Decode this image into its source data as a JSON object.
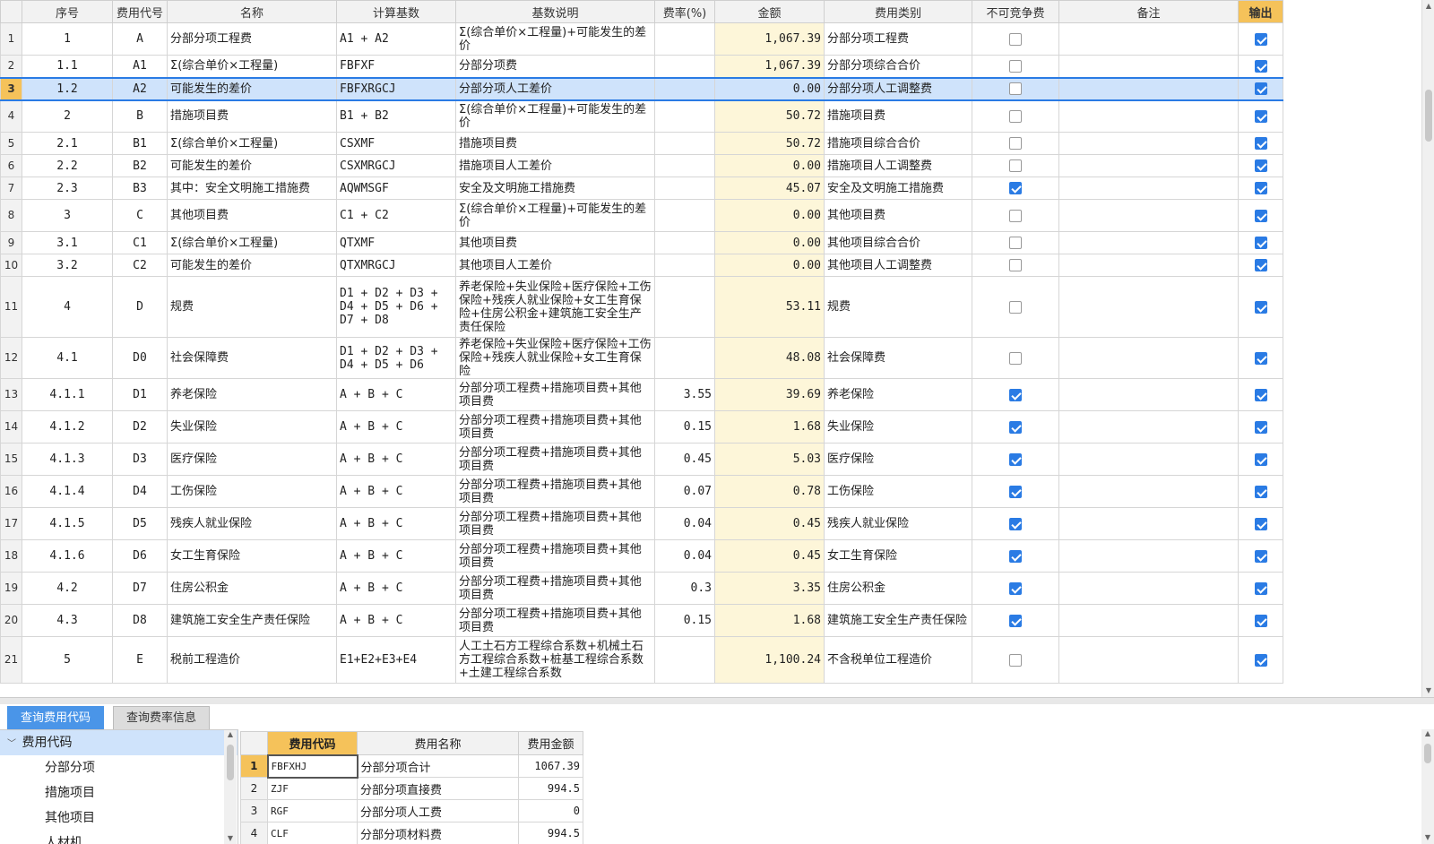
{
  "main_table": {
    "columns": [
      "序号",
      "费用代号",
      "名称",
      "计算基数",
      "基数说明",
      "费率(%)",
      "金额",
      "费用类别",
      "不可竞争费",
      "备注",
      "输出"
    ],
    "rows": [
      {
        "n": "1",
        "seq": "1",
        "code": "A",
        "name": "分部分项工程费",
        "base": "A1 + A2",
        "desc": "Σ(综合单价×工程量)+可能发生的差价",
        "rate": "",
        "amount": "1,067.39",
        "category": "分部分项工程费",
        "noncomp": false,
        "remark": "",
        "output": true
      },
      {
        "n": "2",
        "seq": "1.1",
        "code": "A1",
        "name": "Σ(综合单价×工程量)",
        "base": "FBFXF",
        "desc": "分部分项费",
        "rate": "",
        "amount": "1,067.39",
        "category": "分部分项综合合价",
        "noncomp": false,
        "remark": "",
        "output": true
      },
      {
        "n": "3",
        "seq": "1.2",
        "code": "A2",
        "name": "可能发生的差价",
        "base": "FBFXRGCJ",
        "desc": "分部分项人工差价",
        "rate": "",
        "amount": "0.00",
        "category": "分部分项人工调整费",
        "noncomp": false,
        "remark": "",
        "output": true,
        "selected": true
      },
      {
        "n": "4",
        "seq": "2",
        "code": "B",
        "name": "措施项目费",
        "base": "B1 + B2",
        "desc": "Σ(综合单价×工程量)+可能发生的差价",
        "rate": "",
        "amount": "50.72",
        "category": "措施项目费",
        "noncomp": false,
        "remark": "",
        "output": true
      },
      {
        "n": "5",
        "seq": "2.1",
        "code": "B1",
        "name": "Σ(综合单价×工程量)",
        "base": "CSXMF",
        "desc": "措施项目费",
        "rate": "",
        "amount": "50.72",
        "category": "措施项目综合合价",
        "noncomp": false,
        "remark": "",
        "output": true
      },
      {
        "n": "6",
        "seq": "2.2",
        "code": "B2",
        "name": "可能发生的差价",
        "base": "CSXMRGCJ",
        "desc": "措施项目人工差价",
        "rate": "",
        "amount": "0.00",
        "category": "措施项目人工调整费",
        "noncomp": false,
        "remark": "",
        "output": true
      },
      {
        "n": "7",
        "seq": "2.3",
        "code": "B3",
        "name": "其中：安全文明施工措施费",
        "base": "AQWMSGF",
        "desc": "安全及文明施工措施费",
        "rate": "",
        "amount": "45.07",
        "category": "安全及文明施工措施费",
        "noncomp": true,
        "remark": "",
        "output": true
      },
      {
        "n": "8",
        "seq": "3",
        "code": "C",
        "name": "其他项目费",
        "base": "C1 + C2",
        "desc": "Σ(综合单价×工程量)+可能发生的差价",
        "rate": "",
        "amount": "0.00",
        "category": "其他项目费",
        "noncomp": false,
        "remark": "",
        "output": true
      },
      {
        "n": "9",
        "seq": "3.1",
        "code": "C1",
        "name": "Σ(综合单价×工程量)",
        "base": "QTXMF",
        "desc": "其他项目费",
        "rate": "",
        "amount": "0.00",
        "category": "其他项目综合合价",
        "noncomp": false,
        "remark": "",
        "output": true
      },
      {
        "n": "10",
        "seq": "3.2",
        "code": "C2",
        "name": "可能发生的差价",
        "base": "QTXMRGCJ",
        "desc": "其他项目人工差价",
        "rate": "",
        "amount": "0.00",
        "category": "其他项目人工调整费",
        "noncomp": false,
        "remark": "",
        "output": true
      },
      {
        "n": "11",
        "seq": "4",
        "code": "D",
        "name": "规费",
        "base": "D1 + D2 + D3 + D4 + D5 + D6 + D7 + D8",
        "desc": "养老保险+失业保险+医疗保险+工伤保险+残疾人就业保险+女工生育保险+住房公积金+建筑施工安全生产责任保险",
        "rate": "",
        "amount": "53.11",
        "category": "规费",
        "noncomp": false,
        "remark": "",
        "output": true
      },
      {
        "n": "12",
        "seq": "4.1",
        "code": "D0",
        "name": "社会保障费",
        "base": "D1 + D2 + D3 + D4 + D5 + D6",
        "desc": "养老保险+失业保险+医疗保险+工伤保险+残疾人就业保险+女工生育保险",
        "rate": "",
        "amount": "48.08",
        "category": "社会保障费",
        "noncomp": false,
        "remark": "",
        "output": true
      },
      {
        "n": "13",
        "seq": "4.1.1",
        "code": "D1",
        "name": "养老保险",
        "base": "A + B + C",
        "desc": "分部分项工程费+措施项目费+其他项目费",
        "rate": "3.55",
        "amount": "39.69",
        "category": "养老保险",
        "noncomp": true,
        "remark": "",
        "output": true
      },
      {
        "n": "14",
        "seq": "4.1.2",
        "code": "D2",
        "name": "失业保险",
        "base": "A + B + C",
        "desc": "分部分项工程费+措施项目费+其他项目费",
        "rate": "0.15",
        "amount": "1.68",
        "category": "失业保险",
        "noncomp": true,
        "remark": "",
        "output": true
      },
      {
        "n": "15",
        "seq": "4.1.3",
        "code": "D3",
        "name": "医疗保险",
        "base": "A + B + C",
        "desc": "分部分项工程费+措施项目费+其他项目费",
        "rate": "0.45",
        "amount": "5.03",
        "category": "医疗保险",
        "noncomp": true,
        "remark": "",
        "output": true
      },
      {
        "n": "16",
        "seq": "4.1.4",
        "code": "D4",
        "name": "工伤保险",
        "base": "A + B + C",
        "desc": "分部分项工程费+措施项目费+其他项目费",
        "rate": "0.07",
        "amount": "0.78",
        "category": "工伤保险",
        "noncomp": true,
        "remark": "",
        "output": true
      },
      {
        "n": "17",
        "seq": "4.1.5",
        "code": "D5",
        "name": "残疾人就业保险",
        "base": "A + B + C",
        "desc": "分部分项工程费+措施项目费+其他项目费",
        "rate": "0.04",
        "amount": "0.45",
        "category": "残疾人就业保险",
        "noncomp": true,
        "remark": "",
        "output": true
      },
      {
        "n": "18",
        "seq": "4.1.6",
        "code": "D6",
        "name": "女工生育保险",
        "base": "A + B + C",
        "desc": "分部分项工程费+措施项目费+其他项目费",
        "rate": "0.04",
        "amount": "0.45",
        "category": "女工生育保险",
        "noncomp": true,
        "remark": "",
        "output": true
      },
      {
        "n": "19",
        "seq": "4.2",
        "code": "D7",
        "name": "住房公积金",
        "base": "A + B + C",
        "desc": "分部分项工程费+措施项目费+其他项目费",
        "rate": "0.3",
        "amount": "3.35",
        "category": "住房公积金",
        "noncomp": true,
        "remark": "",
        "output": true
      },
      {
        "n": "20",
        "seq": "4.3",
        "code": "D8",
        "name": "建筑施工安全生产责任保险",
        "base": "A + B + C",
        "desc": "分部分项工程费+措施项目费+其他项目费",
        "rate": "0.15",
        "amount": "1.68",
        "category": "建筑施工安全生产责任保险",
        "noncomp": true,
        "remark": "",
        "output": true
      },
      {
        "n": "21",
        "seq": "5",
        "code": "E",
        "name": "税前工程造价",
        "base": "E1+E2+E3+E4",
        "desc": "人工土石方工程综合系数+机械土石方工程综合系数+桩基工程综合系数+土建工程综合系数",
        "rate": "",
        "amount": "1,100.24",
        "category": "不含税单位工程造价",
        "noncomp": false,
        "remark": "",
        "output": true
      }
    ]
  },
  "bottom_tabs": [
    "查询费用代码",
    "查询费率信息"
  ],
  "tree": {
    "root": "费用代码",
    "children": [
      "分部分项",
      "措施项目",
      "其他项目",
      "人材机"
    ]
  },
  "code_table": {
    "columns": [
      "费用代码",
      "费用名称",
      "费用金额"
    ],
    "rows": [
      {
        "n": "1",
        "code": "FBFXHJ",
        "name": "分部分项合计",
        "amount": "1067.39"
      },
      {
        "n": "2",
        "code": "ZJF",
        "name": "分部分项直接费",
        "amount": "994.5"
      },
      {
        "n": "3",
        "code": "RGF",
        "name": "分部分项人工费",
        "amount": "0"
      },
      {
        "n": "4",
        "code": "CLF",
        "name": "分部分项材料费",
        "amount": "994.5"
      }
    ]
  },
  "colors": {
    "accent": "#2a7be4",
    "header_highlight": "#f5c25a",
    "amount_bg": "#fdf6d9",
    "selection": "#cfe3fb"
  }
}
